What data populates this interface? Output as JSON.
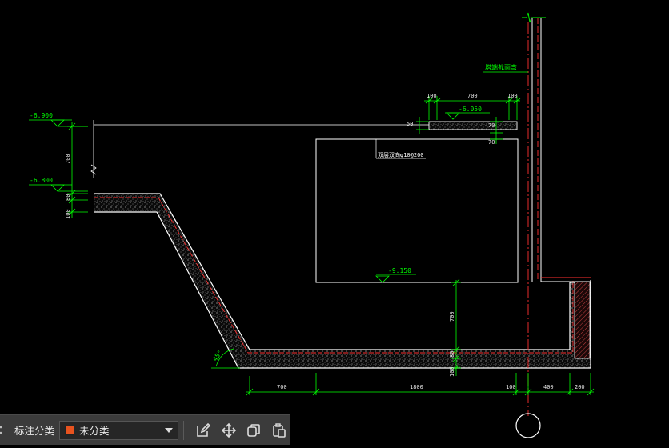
{
  "drawing": {
    "elevations": {
      "top_left": "-6.900",
      "mid_left": "-6.800",
      "slab_top": "-6.050",
      "pit_bottom": "-9.150"
    },
    "labels": {
      "top_note": "塔端截面弯",
      "rebar_note": "双层双向φ10@200"
    },
    "dims_top": [
      "100",
      "700",
      "100"
    ],
    "dims_slab_side": [
      "50",
      "70",
      "70"
    ],
    "dims_left": [
      "700",
      "80",
      "100"
    ],
    "dims_right_vertical": [
      "700",
      "80",
      "100"
    ],
    "dims_bottom": [
      "700",
      "1800",
      "100",
      "400",
      "200"
    ],
    "angle": "45°"
  },
  "toolbar": {
    "category_label": "标注分类",
    "category_value": "未分类",
    "category_color": "#e8531f",
    "icons": [
      "edit-icon",
      "move-icon",
      "copy-icon",
      "paste-icon"
    ]
  },
  "colors": {
    "background": "#000000",
    "dimension": "#00ff00",
    "outline": "#ffffff",
    "centerline": "#ff3030"
  }
}
